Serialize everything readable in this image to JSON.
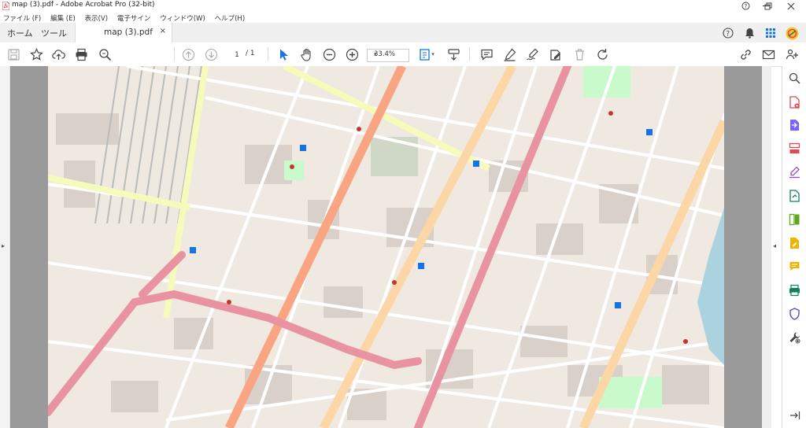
{
  "window": {
    "title": "map (3).pdf - Adobe Acrobat Pro (32-bit)"
  },
  "menu": [
    {
      "label": "ファイル (F)"
    },
    {
      "label": "編集 (E)"
    },
    {
      "label": "表示(V)"
    },
    {
      "label": "電子サイン"
    },
    {
      "label": "ウィンドウ(W)"
    },
    {
      "label": "ヘルプ(H)"
    }
  ],
  "tabs": {
    "home": "ホーム",
    "tools": "ツール",
    "document": "map (3).pdf",
    "close": "×"
  },
  "toolbar": {
    "page_current": "1",
    "page_total": "/ 1",
    "zoom": "33.4%"
  },
  "colors": {
    "accent_blue": "#1473e6",
    "red_pdf": "#e34850",
    "map_background": "#efe9e1",
    "road_major": "#e892a2",
    "road_secondary": "#fcd6a4",
    "road_primary": "#f9a582",
    "road_tertiary": "#f6fabb",
    "park": "#c8facc",
    "water": "#aad3df"
  },
  "right_panel_icons": [
    "search-zoom-icon",
    "create-pdf-icon",
    "export-pdf-icon",
    "organize-pages-icon",
    "fill-sign-icon",
    "send-for-signature-icon",
    "combine-files-icon",
    "edit-pdf-icon",
    "comment-icon",
    "print-production-icon",
    "protect-icon",
    "more-tools-icon"
  ]
}
